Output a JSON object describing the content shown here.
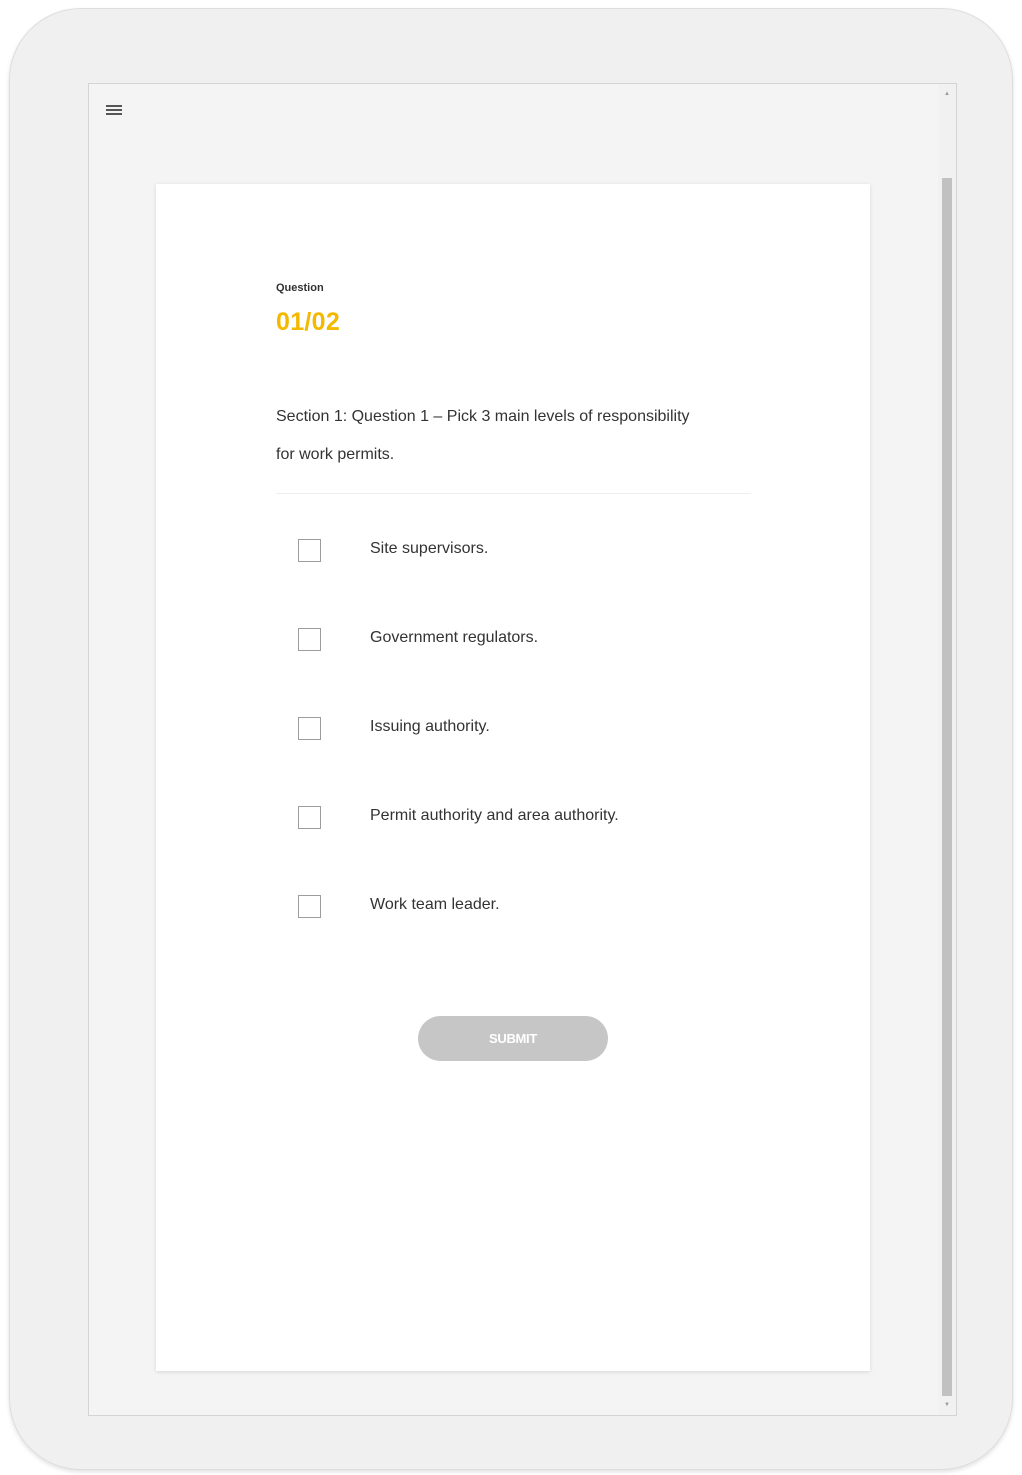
{
  "header": {
    "menu_icon": "hamburger-menu-icon"
  },
  "question": {
    "label": "Question",
    "counter": "01/02",
    "text": "Section 1: Question 1 – Pick 3 main levels of responsibility for work permits."
  },
  "options": [
    {
      "label": "Site supervisors.",
      "checked": false
    },
    {
      "label": "Government regulators.",
      "checked": false
    },
    {
      "label": "Issuing authority.",
      "checked": false
    },
    {
      "label": "Permit authority and area authority.",
      "checked": false
    },
    {
      "label": "Work team leader.",
      "checked": false
    }
  ],
  "submit": {
    "label": "SUBMIT",
    "enabled": false
  },
  "colors": {
    "accent": "#f5b800",
    "button_disabled": "#c6c6c6",
    "text": "#333333"
  }
}
